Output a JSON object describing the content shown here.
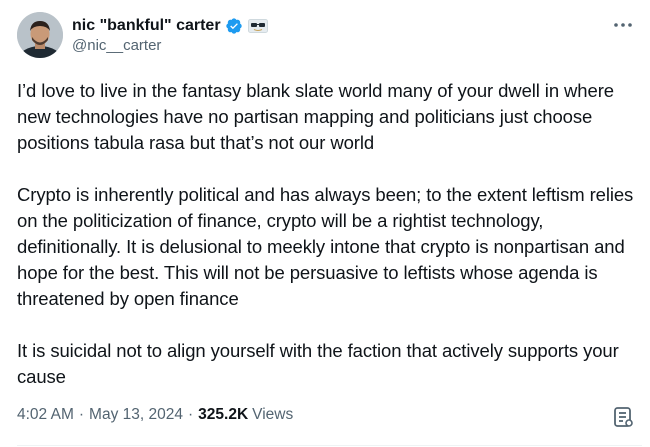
{
  "author": {
    "display_name": "nic \"bankful\" carter",
    "handle": "@nic__carter",
    "verified_icon": "verified-badge-icon",
    "affiliate_icon": "sunglasses-emoji-icon"
  },
  "tweet": {
    "paragraphs": [
      "I’d love to live in the fantasy blank slate world many of your dwell in where new technologies have no partisan mapping and politicians just choose positions tabula rasa but that’s not our world",
      "Crypto is inherently political and has always been; to the extent leftism relies on the politicization of finance, crypto will be a rightist technology, definitionally. It is delusional to meekly intone that crypto is nonpartisan and hope for the best. This will not be persuasive to leftists whose agenda is threatened by open finance",
      "It is suicidal not to align yourself with the faction that actively supports your cause"
    ],
    "time": "4:02 AM",
    "separator": "·",
    "date": "May 13, 2024",
    "views_count": "325.2K",
    "views_label": "Views"
  },
  "colors": {
    "text": "#0f1419",
    "secondary": "#536471",
    "verified": "#1d9bf0"
  }
}
